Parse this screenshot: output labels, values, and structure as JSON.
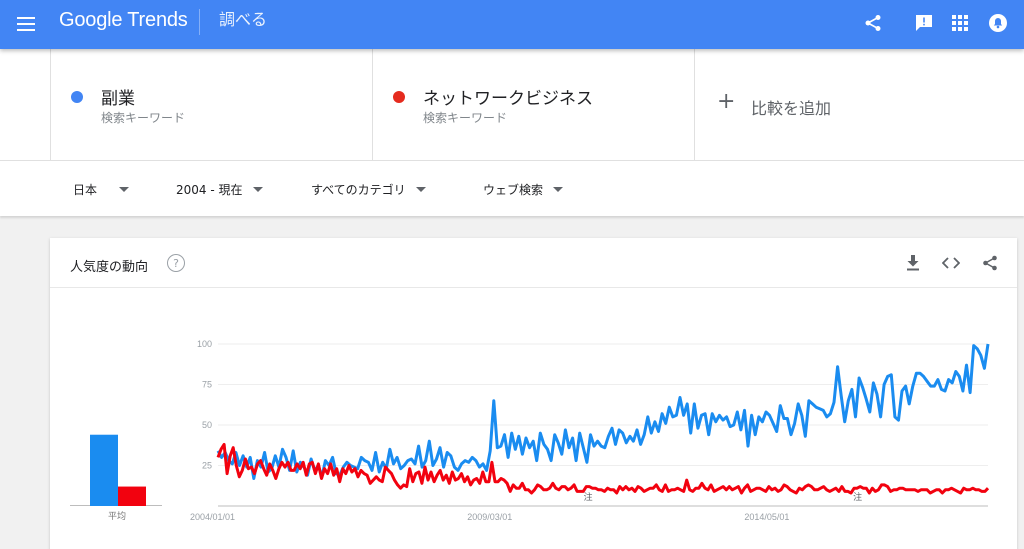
{
  "header": {
    "logo": "Google Trends",
    "section": "調べる",
    "icons": [
      "menu-icon",
      "share-icon",
      "feedback-icon",
      "apps-icon",
      "account-icon"
    ]
  },
  "terms": [
    {
      "name": "副業",
      "sub": "検索キーワード",
      "color": "#4285f4"
    },
    {
      "name": "ネットワークビジネス",
      "sub": "検索キーワード",
      "color": "#e52b1e"
    }
  ],
  "add_compare": {
    "plus": "+",
    "label": "比較を追加"
  },
  "filters": {
    "region": "日本",
    "period": "2004 - 現在",
    "category": "すべてのカテゴリ",
    "search_type": "ウェブ検索"
  },
  "panel": {
    "title": "人気度の動向",
    "help": "?",
    "icons": [
      "download-icon",
      "embed-icon",
      "share-icon"
    ]
  },
  "chart_data": {
    "type": "line",
    "title": "人気度の動向",
    "ylim": [
      0,
      100
    ],
    "yticks": [
      "25",
      "50",
      "75",
      "100"
    ],
    "xticks": [
      {
        "label": "2004/01/01",
        "pos": 0
      },
      {
        "label": "2009/03/01",
        "pos": 0.36
      },
      {
        "label": "2014/05/01",
        "pos": 0.72
      }
    ],
    "notes": [
      {
        "label": "注",
        "pos": 0.48
      },
      {
        "label": "注",
        "pos": 0.83
      }
    ],
    "average": {
      "label": "平均",
      "values": [
        44,
        12
      ]
    },
    "series": [
      {
        "name": "副業",
        "color": "#1a8cf0",
        "values": [
          34,
          30,
          33,
          28,
          26,
          33,
          25,
          31,
          24,
          30,
          17,
          28,
          24,
          33,
          21,
          23,
          31,
          24,
          35,
          30,
          22,
          34,
          21,
          27,
          24,
          19,
          29,
          22,
          25,
          18,
          28,
          25,
          30,
          20,
          19,
          24,
          27,
          25,
          24,
          23,
          30,
          28,
          27,
          22,
          33,
          21,
          27,
          23,
          35,
          26,
          30,
          23,
          25,
          28,
          29,
          26,
          37,
          24,
          28,
          40,
          25,
          29,
          36,
          24,
          33,
          31,
          24,
          22,
          26,
          28,
          27,
          30,
          28,
          24,
          26,
          22,
          34,
          65,
          36,
          37,
          44,
          30,
          45,
          35,
          43,
          32,
          42,
          36,
          40,
          28,
          45,
          38,
          35,
          28,
          44,
          39,
          32,
          47,
          36,
          42,
          28,
          45,
          36,
          27,
          44,
          37,
          40,
          37,
          36,
          43,
          48,
          38,
          47,
          45,
          39,
          43,
          40,
          47,
          38,
          44,
          55,
          45,
          52,
          46,
          57,
          51,
          61,
          55,
          56,
          67,
          56,
          63,
          45,
          63,
          48,
          56,
          57,
          44,
          57,
          52,
          56,
          53,
          55,
          49,
          50,
          58,
          47,
          59,
          37,
          56,
          44,
          55,
          52,
          58,
          56,
          51,
          46,
          62,
          54,
          54,
          44,
          51,
          63,
          56,
          43,
          65,
          63,
          61,
          60,
          59,
          55,
          57,
          64,
          86,
          68,
          52,
          65,
          72,
          55,
          79,
          73,
          66,
          58,
          76,
          69,
          55,
          75,
          80,
          81,
          55,
          53,
          71,
          74,
          63,
          74,
          82,
          82,
          80,
          77,
          74,
          74,
          78,
          72,
          71,
          78,
          76,
          83,
          80,
          71,
          87,
          70,
          99,
          97,
          93,
          85,
          100
        ]
      },
      {
        "name": "ネットワークビジネス",
        "color": "#f2020f",
        "values": [
          30,
          35,
          38,
          20,
          31,
          36,
          25,
          18,
          22,
          29,
          23,
          24,
          20,
          26,
          28,
          23,
          19,
          26,
          22,
          17,
          23,
          27,
          24,
          27,
          22,
          22,
          26,
          23,
          27,
          19,
          26,
          27,
          20,
          26,
          17,
          23,
          20,
          26,
          19,
          23,
          15,
          23,
          20,
          25,
          21,
          23,
          18,
          22,
          20,
          19,
          14,
          16,
          18,
          16,
          15,
          24,
          22,
          20,
          16,
          13,
          11,
          13,
          12,
          23,
          15,
          20,
          21,
          14,
          24,
          16,
          21,
          15,
          19,
          22,
          16,
          19,
          14,
          21,
          16,
          17,
          20,
          15,
          18,
          13,
          16,
          17,
          14,
          21,
          15,
          15,
          27,
          15,
          15,
          17,
          16,
          14,
          9,
          13,
          11,
          11,
          14,
          10,
          10,
          8,
          10,
          13,
          12,
          10,
          10,
          11,
          14,
          11,
          10,
          12,
          12,
          10,
          11,
          13,
          9,
          9,
          9,
          12,
          12,
          11,
          11,
          10,
          10,
          9,
          11,
          10,
          10,
          8,
          12,
          10,
          12,
          10,
          11,
          9,
          12,
          11,
          9,
          10,
          11,
          11,
          13,
          10,
          9,
          13,
          9,
          10,
          10,
          11,
          10,
          9,
          16,
          10,
          9,
          11,
          11,
          14,
          11,
          10,
          13,
          9,
          10,
          11,
          12,
          10,
          12,
          10,
          11,
          12,
          8,
          11,
          13,
          9,
          10,
          11,
          11,
          10,
          9,
          12,
          10,
          11,
          9,
          10,
          13,
          12,
          10,
          9,
          8,
          11,
          10,
          12,
          13,
          12,
          10,
          10,
          11,
          12,
          10,
          9,
          10,
          11,
          9,
          12,
          9,
          9,
          8,
          11,
          11,
          12,
          11,
          11,
          8,
          11,
          9,
          10,
          13,
          13,
          12,
          9,
          10,
          10,
          11,
          11,
          10,
          10,
          10,
          10,
          9,
          10,
          10,
          10,
          8,
          9,
          10,
          10,
          8,
          10,
          10,
          11,
          10,
          9,
          8,
          11,
          10,
          10,
          11,
          10,
          10,
          9,
          9,
          11
        ]
      }
    ]
  }
}
